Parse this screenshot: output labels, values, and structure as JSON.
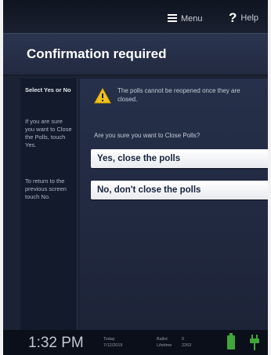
{
  "topbar": {
    "menu_label": "Menu",
    "help_label": "Help"
  },
  "header": {
    "title": "Confirmation required"
  },
  "sidebar": {
    "title": "Select Yes or No",
    "instruction_1": "If you are sure you want to Close the Polls, touch Yes.",
    "instruction_2": "To return to the previous screen touch No."
  },
  "main": {
    "warning_text": "The polls cannot be reopened once they are closed.",
    "question": "Are you sure you want to Close Polls?",
    "yes_label": "Yes, close the polls",
    "no_label": "No, don't close the polls"
  },
  "footer": {
    "time": "1:32 PM",
    "date_label": "Today",
    "date": "7/12/2019",
    "ballot_label": "Ballot",
    "ballot_value": "0",
    "lifetime_label": "Lifetime",
    "lifetime_value": "2263"
  },
  "colors": {
    "background": "#1b2233",
    "header": "#2b3550",
    "button": "#ffffff",
    "warning": "#f1c21b",
    "battery": "#3fa63a"
  }
}
